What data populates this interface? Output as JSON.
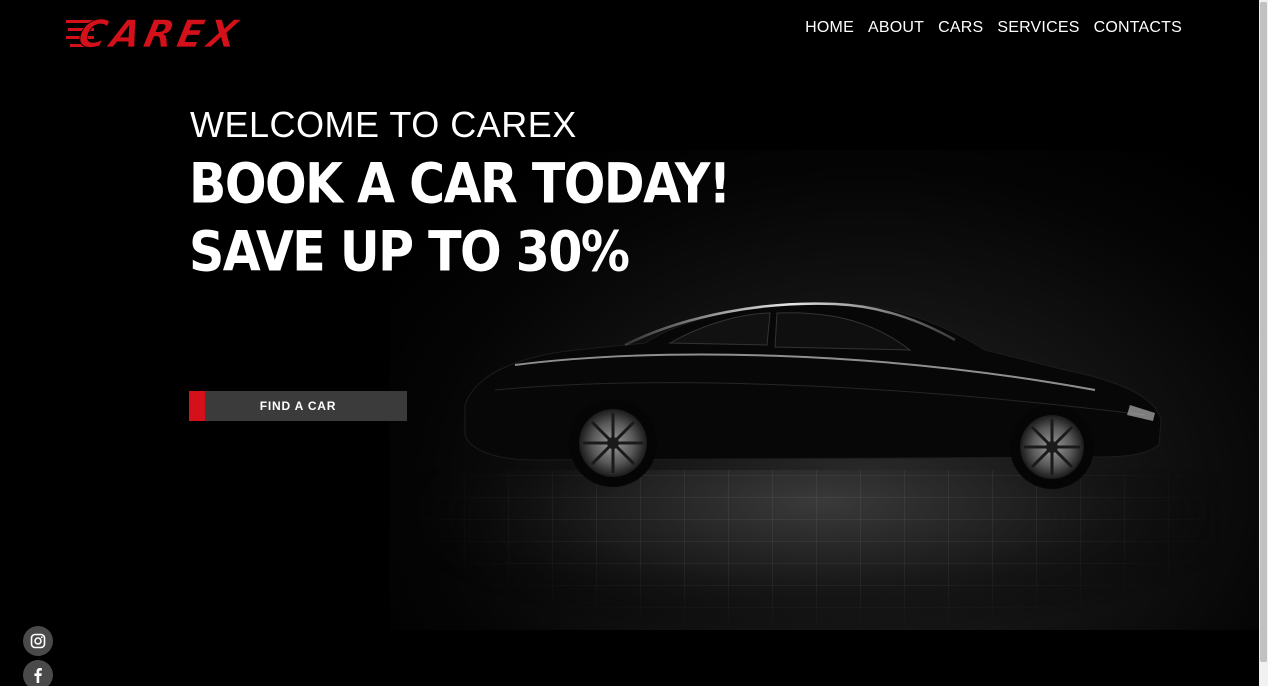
{
  "brand": {
    "logo_text": "CAREX",
    "accent_color": "#d4101a"
  },
  "nav": {
    "items": [
      {
        "label": "HOME"
      },
      {
        "label": "ABOUT"
      },
      {
        "label": "CARS"
      },
      {
        "label": "SERVICES"
      },
      {
        "label": "CONTACTS"
      }
    ]
  },
  "hero": {
    "welcome": "WELCOME TO CAREX",
    "headline_1": "BOOK A CAR TODAY!",
    "headline_2": "SAVE UP TO 30%",
    "cta_label": "FIND A CAR"
  },
  "social": {
    "icons": [
      "instagram-icon",
      "facebook-icon"
    ]
  }
}
